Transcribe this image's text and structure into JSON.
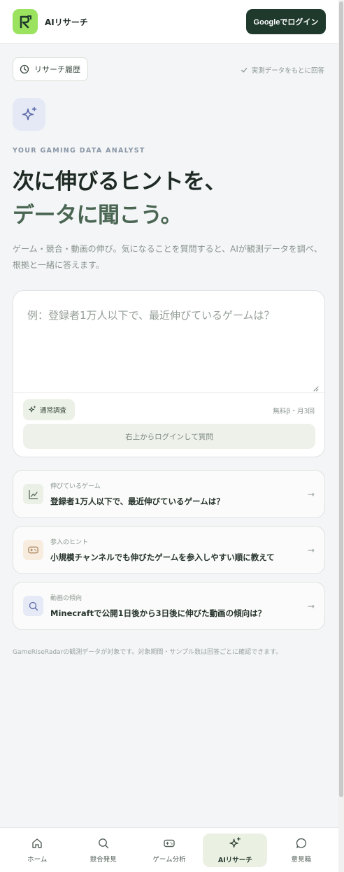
{
  "header": {
    "app_title": "AIリサーチ",
    "login_label": "Googleでログイン"
  },
  "toolbar": {
    "history_label": "リサーチ履歴",
    "observed_note": "実測データをもとに回答"
  },
  "hero": {
    "eyebrow": "YOUR GAMING DATA ANALYST",
    "headline_line1": "次に伸びるヒントを、",
    "headline_line2": "データに聞こう。",
    "intro": "ゲーム・競合・動画の伸び。気になることを質問すると、AIが観測データを調べ、根拠と一緒に答えます。"
  },
  "ask": {
    "placeholder": "例：登録者1万人以下で、最近伸びているゲームは？",
    "mode_label": "通常調査",
    "quota": "無料β・月3回",
    "submit_label": "右上からログインして質問"
  },
  "suggestions": [
    {
      "category": "伸びているゲーム",
      "question": "登録者1万人以下で、最近伸びているゲームは？",
      "icon": "trend-chart-icon"
    },
    {
      "category": "参入のヒント",
      "question": "小規模チャンネルでも伸びたゲームを参入しやすい順に教えて",
      "icon": "gamepad-icon"
    },
    {
      "category": "動画の傾向",
      "question": "Minecraftで公開1日後から3日後に伸びた動画の傾向は？",
      "icon": "search-icon"
    }
  ],
  "footnote": "GameRiseRadarの観測データが対象です。対象期間・サンプル数は回答ごとに確認できます。",
  "nav": [
    {
      "label": "ホーム",
      "icon": "home-icon"
    },
    {
      "label": "競合発見",
      "icon": "search-icon"
    },
    {
      "label": "ゲーム分析",
      "icon": "gamepad-icon"
    },
    {
      "label": "AIリサーチ",
      "icon": "sparkle-icon",
      "active": true
    },
    {
      "label": "意見箱",
      "icon": "chat-bubble-icon"
    }
  ],
  "colors": {
    "brand_green": "#9be35f",
    "login_button": "#1f3a2d",
    "headline_accent": "#4a6652"
  }
}
